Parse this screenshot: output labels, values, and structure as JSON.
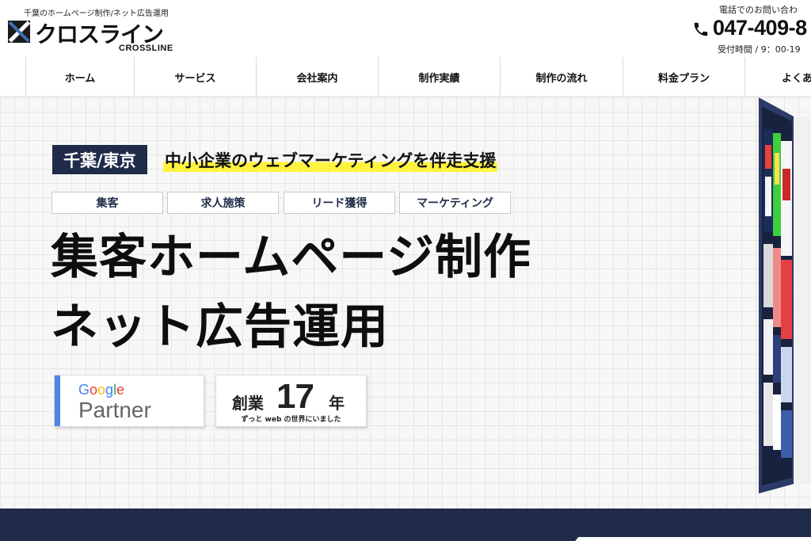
{
  "header": {
    "tagline": "千葉のホームページ制作/ネット広告運用",
    "logo_text": "クロスライン",
    "logo_sub": "CROSSLINE"
  },
  "contact": {
    "label": "電話でのお問い合わ",
    "phone": "047-409-8",
    "hours": "受付時間 / 9：00-19"
  },
  "nav": {
    "items": [
      {
        "label": "ホーム"
      },
      {
        "label": "サービス"
      },
      {
        "label": "会社案内"
      },
      {
        "label": "制作実績"
      },
      {
        "label": "制作の流れ"
      },
      {
        "label": "料金プラン"
      },
      {
        "label": "よくあ"
      }
    ]
  },
  "hero": {
    "region": "千葉/東京",
    "catch": "中小企業のウェブマーケティングを伴走支援",
    "tags": [
      "集客",
      "求人施策",
      "リード獲得",
      "マーケティング"
    ],
    "headline_1": "集客ホームページ制作",
    "headline_2": "ネット広告運用",
    "partner": {
      "google": "Google",
      "partner": "Partner",
      "google_colors": [
        "#4285F4",
        "#EA4335",
        "#FBBC05",
        "#4285F4",
        "#34A853",
        "#EA4335"
      ]
    },
    "years": {
      "prefix": "創業",
      "number": "17",
      "unit": "年",
      "sub": "ずっと web の世界にいました"
    }
  },
  "colors": {
    "navy": "#1f2b48",
    "highlight": "#fff33f",
    "partner_blue": "#4b86e8"
  }
}
